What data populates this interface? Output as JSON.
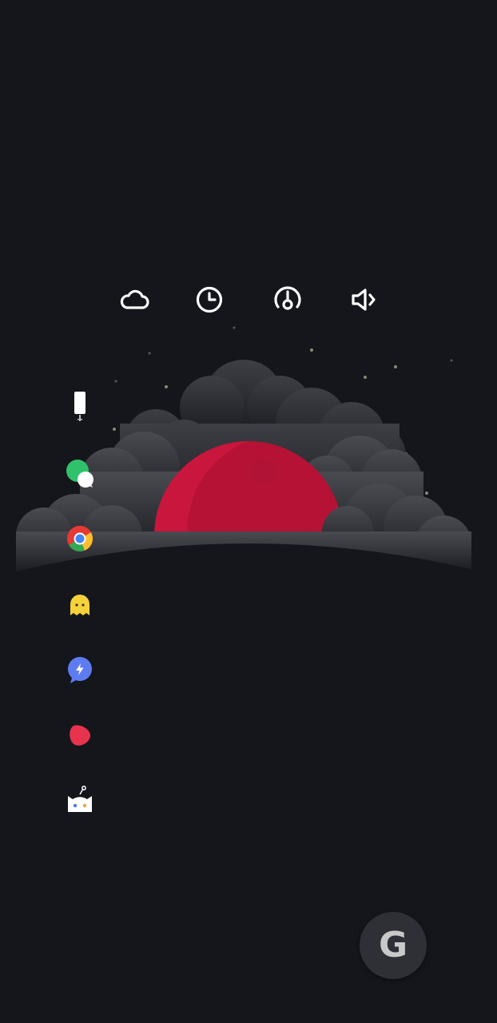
{
  "widgets": [
    {
      "icon": "cloud-icon"
    },
    {
      "icon": "clock-icon"
    },
    {
      "icon": "speedometer-icon"
    },
    {
      "icon": "volume-icon"
    }
  ],
  "dock": {
    "apps": [
      {
        "icon": "phone-app-icon"
      },
      {
        "icon": "messages-app-icon"
      },
      {
        "icon": "chrome-app-icon"
      },
      {
        "icon": "ghost-app-icon"
      },
      {
        "icon": "messenger-app-icon"
      },
      {
        "icon": "red-blob-app-icon"
      },
      {
        "icon": "reddit-app-icon"
      }
    ]
  },
  "search": {
    "glyph": "G"
  },
  "colors": {
    "background": "#15161b",
    "moon": "#c8163d",
    "cloud": "#3a3b40",
    "icon": "#ffffff",
    "search_button": "#2f3035"
  }
}
